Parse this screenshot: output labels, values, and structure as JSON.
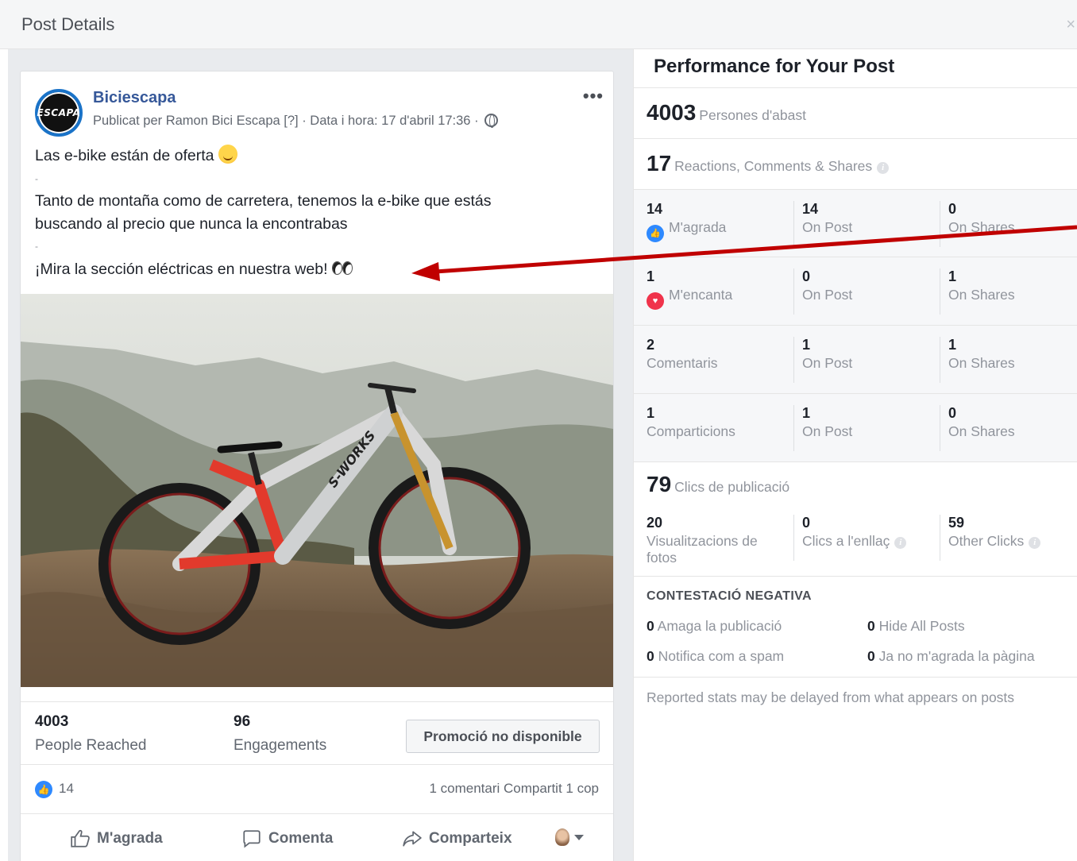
{
  "dialog": {
    "title": "Post Details",
    "close_label": "×"
  },
  "post": {
    "page_name": "Biciescapa",
    "avatar_text": "ESCAPA",
    "meta": "Publicat per Ramon Bici Escapa [?] · Data i hora: 17 d'abril 17:36 ·",
    "more_label": "•••",
    "line1": "Las e-bike están de oferta",
    "dash": "-",
    "line2": "Tanto de montaña como de carretera, tenemos la e-bike que estás buscando al precio que nunca la encontrabas",
    "line3": "¡Mira la sección eléctricas en nuestra web!",
    "image_label": "S-WORKS",
    "stats": {
      "reached_value": "4003",
      "reached_label": "People Reached",
      "engagements_value": "96",
      "engagements_label": "Engagements",
      "promo_label": "Promoció no disponible"
    },
    "reactions_count": "14",
    "comments_shares": "1 comentari  Compartit 1 cop",
    "actions": {
      "like": "M'agrada",
      "comment": "Comenta",
      "share": "Comparteix"
    }
  },
  "performance": {
    "title": "Performance for Your Post",
    "reach": {
      "value": "4003",
      "label": "Persones d'abast"
    },
    "engagement": {
      "value": "17",
      "label": "Reactions, Comments & Shares"
    },
    "rows": [
      {
        "total": "14",
        "label": "M'agrada",
        "icon": "like",
        "post": "14",
        "post_label": "On Post",
        "shares": "0",
        "shares_label": "On Shares"
      },
      {
        "total": "1",
        "label": "M'encanta",
        "icon": "love",
        "post": "0",
        "post_label": "On Post",
        "shares": "1",
        "shares_label": "On Shares"
      },
      {
        "total": "2",
        "label": "Comentaris",
        "icon": "",
        "post": "1",
        "post_label": "On Post",
        "shares": "1",
        "shares_label": "On Shares"
      },
      {
        "total": "1",
        "label": "Comparticions",
        "icon": "",
        "post": "1",
        "post_label": "On Post",
        "shares": "0",
        "shares_label": "On Shares"
      }
    ],
    "clicks": {
      "value": "79",
      "label": "Clics de publicació"
    },
    "click_breakdown": [
      {
        "value": "20",
        "label": "Visualitzacions de fotos"
      },
      {
        "value": "0",
        "label": "Clics a l'enllaç"
      },
      {
        "value": "59",
        "label": "Other Clicks"
      }
    ],
    "negative": {
      "title": "CONTESTACIÓ NEGATIVA",
      "hide_post": {
        "value": "0",
        "label": "Amaga la publicació"
      },
      "hide_all": {
        "value": "0",
        "label": "Hide All Posts"
      },
      "spam": {
        "value": "0",
        "label": "Notifica com a spam"
      },
      "unlike": {
        "value": "0",
        "label": "Ja no m'agrada la pàgina"
      }
    },
    "footnote": "Reported stats may be delayed from what appears on posts"
  },
  "colors": {
    "link": "#365899",
    "like": "#2e89ff",
    "love": "#f0334b",
    "annotation_arrow": "#c00000"
  },
  "icons": [
    "globe-icon",
    "more-icon",
    "like-icon",
    "comment-icon",
    "share-icon",
    "info-icon",
    "close-icon",
    "love-icon"
  ]
}
